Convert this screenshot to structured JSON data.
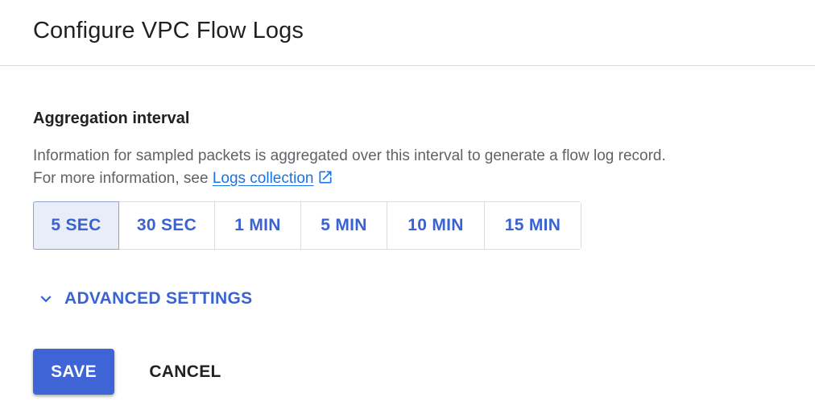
{
  "header": {
    "title": "Configure VPC Flow Logs"
  },
  "aggregation": {
    "title": "Aggregation interval",
    "description_line1": "Information for sampled packets is aggregated over this interval to generate a flow log record.",
    "description_prefix": "For more information, see ",
    "link_label": "Logs collection",
    "link_icon": "open-in-new-icon",
    "options": [
      {
        "label": "5 SEC",
        "selected": true
      },
      {
        "label": "30 SEC",
        "selected": false
      },
      {
        "label": "1 MIN",
        "selected": false
      },
      {
        "label": "5 MIN",
        "selected": false
      },
      {
        "label": "10 MIN",
        "selected": false
      },
      {
        "label": "15 MIN",
        "selected": false
      }
    ]
  },
  "advanced": {
    "label": "ADVANCED SETTINGS",
    "icon": "chevron-down-icon"
  },
  "actions": {
    "save_label": "SAVE",
    "cancel_label": "CANCEL"
  },
  "colors": {
    "accent": "#3b63d0",
    "primary_button": "#3f64d6",
    "link": "#1a73e8",
    "selected_bg": "#e8edf7",
    "border": "#dadce0"
  }
}
